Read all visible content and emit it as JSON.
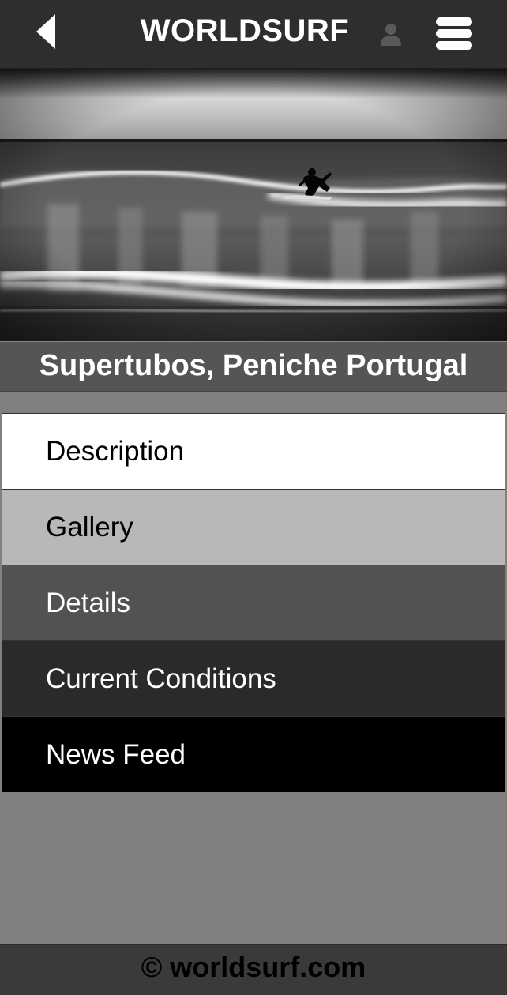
{
  "header": {
    "title": "WORLDSURF",
    "back_icon": "back-arrow-icon",
    "user_icon": "user-icon",
    "menu_icon": "hamburger-menu-icon"
  },
  "hero": {
    "image": "black-and-white photo of a surfer riding a breaking wave"
  },
  "location": {
    "title": "Supertubos, Peniche Portugal"
  },
  "menu": {
    "items": [
      {
        "label": "Description"
      },
      {
        "label": "Gallery"
      },
      {
        "label": "Details"
      },
      {
        "label": "Current Conditions"
      },
      {
        "label": "News Feed"
      }
    ]
  },
  "footer": {
    "copyright": "© worldsurf.com"
  },
  "colors": {
    "header_bg": "#2e2e2e",
    "page_bg": "#808080",
    "location_bar_bg": "#555555",
    "footer_bg": "#3a3a3a"
  }
}
